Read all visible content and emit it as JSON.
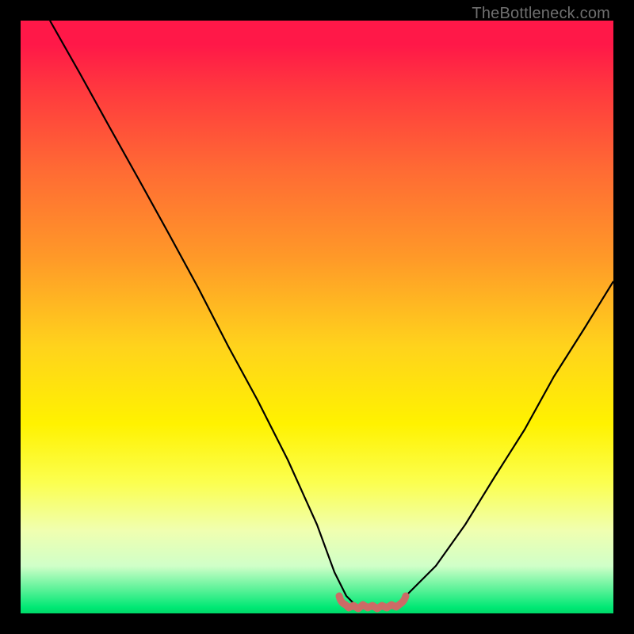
{
  "watermark": {
    "text": "TheBottleneck.com"
  },
  "chart_data": {
    "type": "line",
    "title": "",
    "xlabel": "",
    "ylabel": "",
    "xlim": [
      0,
      100
    ],
    "ylim": [
      0,
      100
    ],
    "series": [
      {
        "name": "bottleneck-curve",
        "x": [
          5,
          10,
          15,
          20,
          25,
          30,
          35,
          40,
          45,
          50,
          53,
          55,
          57,
          60,
          63,
          65,
          70,
          75,
          80,
          85,
          90,
          95,
          100
        ],
        "values": [
          100,
          91,
          82,
          73,
          64,
          55,
          45,
          36,
          26,
          15,
          7,
          3,
          1,
          1,
          1,
          3,
          8,
          15,
          23,
          31,
          40,
          48,
          56
        ]
      }
    ],
    "annotations": [
      {
        "name": "flat-bottom-band",
        "x_start": 54,
        "x_end": 64,
        "y": 1
      }
    ],
    "colorscale": "rainbow-vertical",
    "grid": false,
    "legend": false
  }
}
